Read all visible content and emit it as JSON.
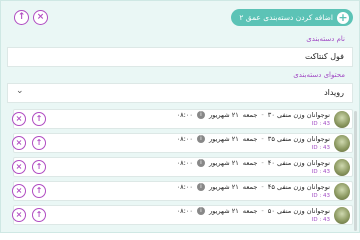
{
  "header": {
    "add_label": "اضافه کردن دسته‌بندی عمق ۲",
    "plus_glyph": "+",
    "up_glyph": "↑",
    "close_glyph": "×"
  },
  "category_name": {
    "label": "نام دسته‌بندی",
    "value": "فول کنتاکت"
  },
  "category_content": {
    "label": "محتوای دسته‌بندی",
    "value": "رویداد",
    "chevron": "⌄"
  },
  "items": [
    {
      "title": "نوجوانان وزن منفی ۳۰",
      "day": "جمعه",
      "date": "۲۱ شهریور",
      "time": "۰۸:۰۰",
      "id": "ID : 43"
    },
    {
      "title": "نوجوانان وزن منفی ۳۵",
      "day": "جمعه",
      "date": "۲۱ شهریور",
      "time": "۰۸:۰۰",
      "id": "ID : 43"
    },
    {
      "title": "نوجوانان وزن منفی ۴۰",
      "day": "جمعه",
      "date": "۲۱ شهریور",
      "time": "۰۸:۰۰",
      "id": "ID : 43"
    },
    {
      "title": "نوجوانان وزن منفی ۴۵",
      "day": "جمعه",
      "date": "۲۱ شهریور",
      "time": "۰۸:۰۰",
      "id": "ID : 43"
    },
    {
      "title": "نوجوانان وزن منفی ۵۰",
      "day": "جمعه",
      "date": "۲۱ شهریور",
      "time": "۰۸:۰۰",
      "id": "ID : 43"
    }
  ],
  "colors": {
    "accent": "#5cc3b6",
    "purple": "#b04cc2",
    "panel": "#eaf7f5"
  }
}
